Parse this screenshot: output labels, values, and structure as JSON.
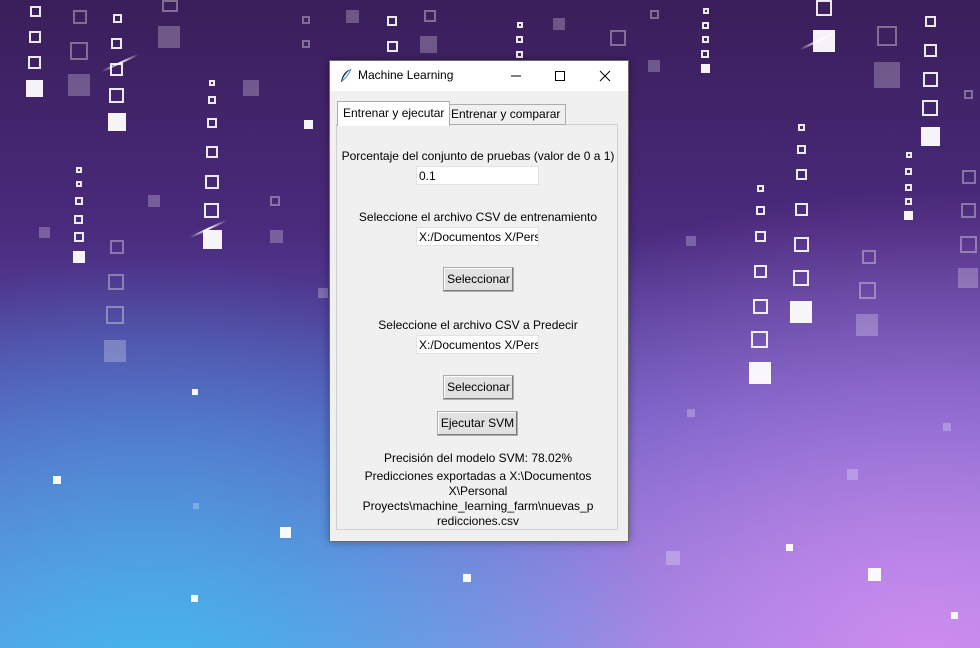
{
  "window": {
    "title": "Machine Learning"
  },
  "tabs": [
    {
      "label": "Entrenar y ejecutar",
      "selected": true
    },
    {
      "label": "Entrenar y comparar",
      "selected": false
    }
  ],
  "form": {
    "test_split_label": "Porcentaje del conjunto de pruebas (valor de 0 a 1)",
    "test_split_value": "0.1",
    "train_csv_label": "Seleccione el archivo CSV de entrenamiento",
    "train_csv_value": "X:/Documentos X/Pers",
    "train_select_button": "Seleccionar",
    "predict_csv_label": "Seleccione el archivo CSV a Predecir",
    "predict_csv_value": "X:/Documentos X/Pers",
    "predict_select_button": "Seleccionar",
    "run_button": "Ejecutar SVM"
  },
  "results": {
    "accuracy_text": "Precisión del modelo SVM: 78.02%",
    "export_line1": "Predicciones exportadas a X:\\Documentos",
    "export_line2": "X\\Personal",
    "export_line3": "Proyects\\machine_learning_farm\\nuevas_p",
    "export_line4": "redicciones.csv"
  },
  "icons": {
    "app": "feather-icon",
    "minimize": "minimize-icon",
    "maximize": "maximize-icon",
    "close": "close-icon"
  }
}
